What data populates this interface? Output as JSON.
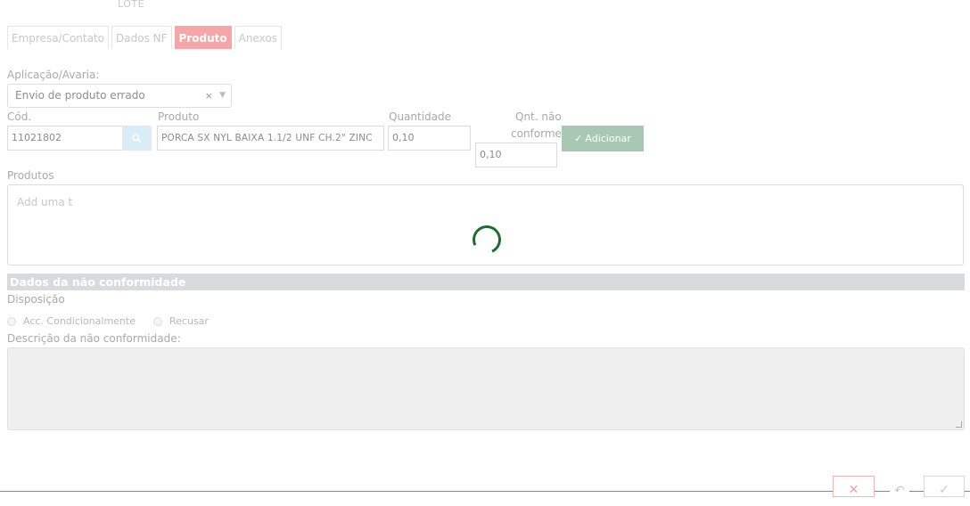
{
  "header": {
    "lote_label": "LOTE"
  },
  "tabs": [
    {
      "label": "Empresa/Contato",
      "active": false
    },
    {
      "label": "Dados NF",
      "active": false
    },
    {
      "label": "Produto",
      "active": true
    },
    {
      "label": "Anexos",
      "active": false
    }
  ],
  "aplicacao": {
    "label": "Aplicação/Avaria:",
    "value": "Envio de produto errado",
    "clear": "×",
    "caret": "▼"
  },
  "fields": {
    "cod_label": "Cód.",
    "cod_value": "11021802",
    "produto_label": "Produto",
    "produto_value": "PORCA SX NYL BAIXA 1.1/2 UNF CH.2\" ZINC",
    "quantidade_label": "Quantidade",
    "quantidade_value": "0,10",
    "qnt_nao_label_1": "Qnt. não",
    "qnt_nao_label_2": "conforme",
    "qnt_nao_value": "0,10",
    "add_button": "Adicionar"
  },
  "produtos": {
    "label": "Produtos",
    "placeholder": "Add uma ta"
  },
  "nao_conformidade": {
    "section_title": "Dados da não conformidade",
    "disposicao_label": "Disposição",
    "options": [
      "Acc. Condicionalmente",
      "Recusar"
    ],
    "descricao_label": "Descrição da não conformidade:"
  },
  "footer": {
    "cancel": "✕",
    "undo": "↶",
    "confirm": "✓"
  },
  "colors": {
    "active_tab": "#f6a6a6",
    "add_button": "#a7c9b3",
    "spinner": "#1a6e2a",
    "section_head": "#d9dadb"
  }
}
